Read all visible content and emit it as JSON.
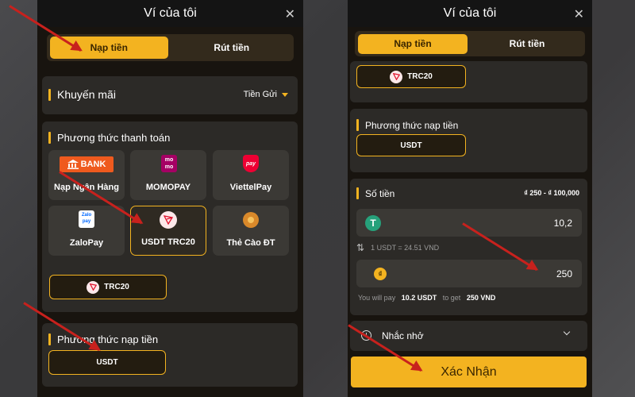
{
  "left": {
    "title": "Ví của tôi",
    "close": "✕",
    "tabs": [
      "Nạp tiền",
      "Rút tiền"
    ],
    "promo": {
      "label": "Khuyến mãi",
      "value": "Tiền Gửi"
    },
    "payment": {
      "label": "Phương thức thanh toán",
      "methods": [
        {
          "label": "Nạp Ngân Hàng",
          "icon": "bank-logo-icon",
          "logo_text": "BANK"
        },
        {
          "label": "MOMOPAY",
          "icon": "momo-logo-icon",
          "logo_text": "mo mo"
        },
        {
          "label": "ViettelPay",
          "icon": "viettelpay-logo-icon",
          "logo_text": "pay"
        },
        {
          "label": "ZaloPay",
          "icon": "zalopay-logo-icon",
          "logo_text": "Zalo pay"
        },
        {
          "label": "USDT TRC20",
          "icon": "tron-logo-icon",
          "selected": true
        },
        {
          "label": "Thẻ Cào ĐT",
          "icon": "phone-card-icon"
        }
      ]
    },
    "network": "TRC20",
    "deposit_method": {
      "label": "Phương thức nạp tiền",
      "value": "USDT"
    }
  },
  "right": {
    "title": "Ví của tôi",
    "close": "✕",
    "tabs": [
      "Nạp tiền",
      "Rút tiền"
    ],
    "network": "TRC20",
    "deposit_method": {
      "label": "Phương thức nạp tiền",
      "value": "USDT"
    },
    "amount": {
      "label": "Số tiền",
      "range": "₫ 250 - ₫ 100,000",
      "usdt_value": "10,2",
      "rate": "1 USDT = 24.51 VND",
      "vnd_value": "250",
      "pay_prefix": "You will pay",
      "pay_amount": "10.2 USDT",
      "get_prefix": "to get",
      "get_amount": "250 VND"
    },
    "reminder": "Nhắc nhở",
    "confirm": "Xác Nhận"
  },
  "colors": {
    "accent": "#f3b320",
    "panel": "#18140f",
    "card": "#2c2a27",
    "arrow": "#c8211d"
  }
}
